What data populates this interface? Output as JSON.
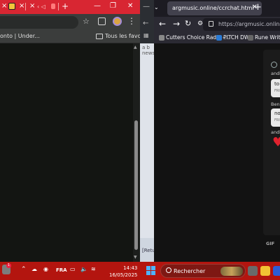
{
  "left_browser": {
    "title_tabs": [
      "‹ ◁"
    ],
    "toolbar": {
      "star": "☆",
      "menu": "⋮"
    },
    "bookmarks": {
      "item_1": "onto | Under...",
      "all_bookmarks": "Tous les favoris"
    }
  },
  "middle_doc": {
    "snippet_1": "a  b",
    "snippet_2": "news",
    "snippet_3": "[Retu"
  },
  "right_browser": {
    "tab_title": "argmusic.online/ccrchat.html",
    "url": "https://argmusic.online/cc",
    "bookmarks": [
      "Cutters Choice Radio -...",
      "PITCH DW",
      "Rune Writer"
    ],
    "chat": {
      "messages": [
        {
          "user": "andil",
          "text": "to",
          "sub": "FRI"
        },
        {
          "user": "Benn",
          "text": "no",
          "sub": "FRI"
        },
        {
          "user": "andil",
          "text": "",
          "sub": ""
        }
      ],
      "gif_label": "GIF"
    }
  },
  "taskbar": {
    "language": "FRA",
    "time": "14:43",
    "date": "16/05/2025",
    "search_placeholder": "Rechercher",
    "badge_count": "1"
  },
  "colors": {
    "taskbar_red": "#b3150f",
    "left_titlebar_red": "#d82632",
    "heart_red": "#e0222e",
    "windows_blue": "#4fb3ff"
  },
  "icons": [
    "menu-icon",
    "star-icon",
    "extension-icon",
    "avatar-icon",
    "folder-icon",
    "back-icon",
    "forward-icon",
    "reload-icon",
    "lock-icon",
    "heart-icon",
    "windows-icon",
    "search-icon",
    "chevron-up-icon",
    "speaker-icon",
    "battery-icon"
  ]
}
